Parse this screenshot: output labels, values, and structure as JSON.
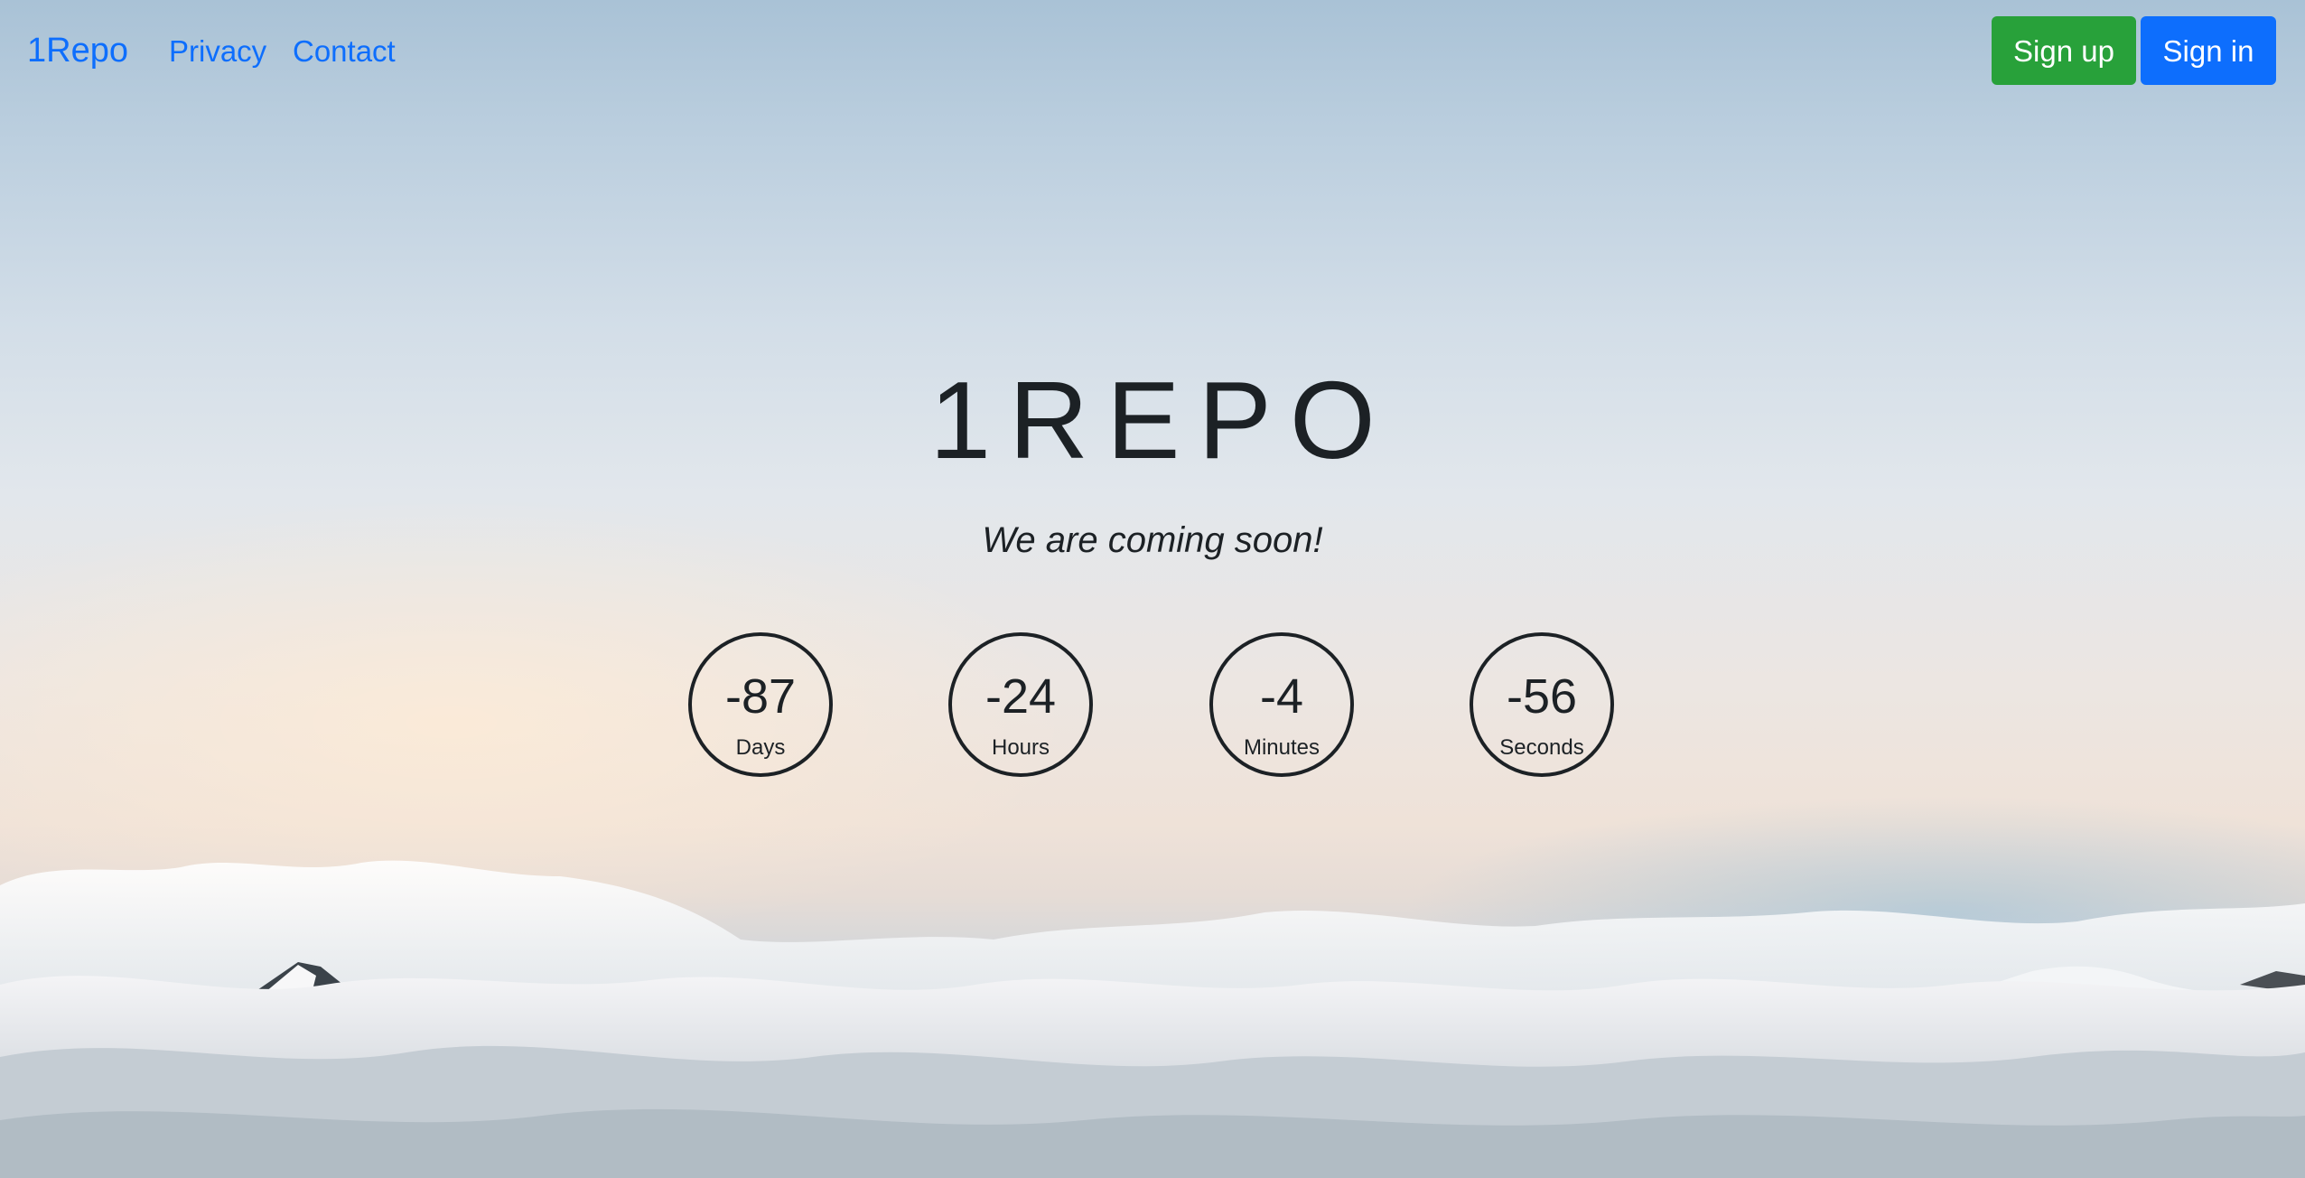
{
  "navbar": {
    "brand": "1Repo",
    "links": [
      "Privacy",
      "Contact"
    ],
    "signup_label": "Sign up",
    "signin_label": "Sign in"
  },
  "hero": {
    "title": "1REPO",
    "tagline": "We are coming soon!"
  },
  "countdown": [
    {
      "value": "-87",
      "label": "Days"
    },
    {
      "value": "-24",
      "label": "Hours"
    },
    {
      "value": "-4",
      "label": "Minutes"
    },
    {
      "value": "-56",
      "label": "Seconds"
    }
  ],
  "colors": {
    "link": "#0d6efd",
    "signup": "#28a13a",
    "signin": "#0d6efd",
    "text": "#1c2125"
  }
}
